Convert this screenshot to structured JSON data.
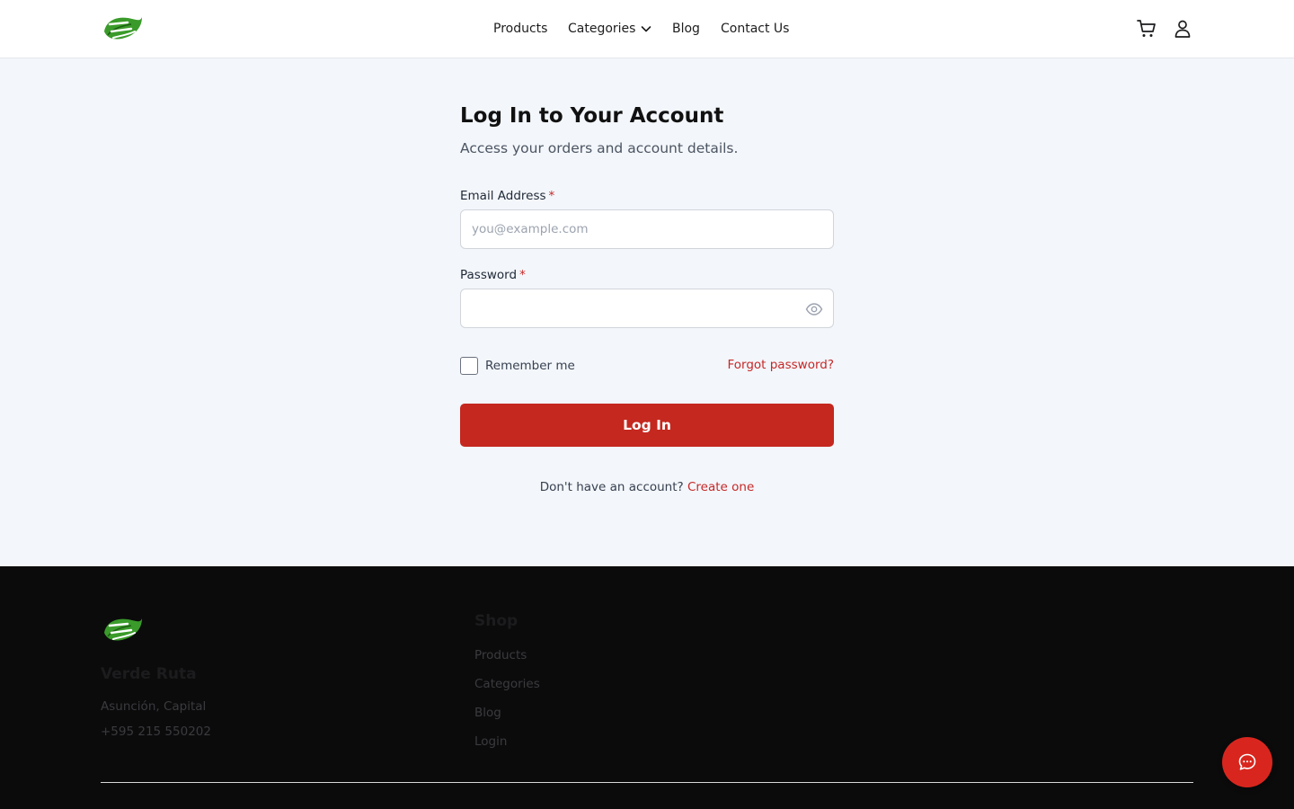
{
  "header": {
    "brand": "Verde Ruta",
    "nav": {
      "products": "Products",
      "categories": "Categories",
      "blog": "Blog",
      "contact": "Contact Us"
    }
  },
  "login": {
    "title": "Log In to Your Account",
    "subtitle": "Access your orders and account details.",
    "email_label": "Email Address",
    "email_placeholder": "you@example.com",
    "email_value": "",
    "password_label": "Password",
    "password_value": "",
    "required_mark": "*",
    "remember_label": "Remember me",
    "remember_checked": false,
    "forgot_label": "Forgot password?",
    "submit_label": "Log In",
    "signup_prompt": "Don't have an account?",
    "signup_link": "Create one"
  },
  "footer": {
    "brand": "Verde Ruta",
    "address": "Asunción, Capital",
    "phone": "+595 215 550202",
    "shop_heading": "Shop",
    "shop_links": [
      "Products",
      "Categories",
      "Blog",
      "Login"
    ]
  },
  "colors": {
    "accent": "#c4281f",
    "link": "#c62828",
    "page_bg": "#f3f6fa",
    "footer_bg": "#0b0b0c",
    "logo_green": "#3a9b2a"
  },
  "icons": {
    "cart": "shopping-cart-icon",
    "user": "user-icon",
    "eye": "eye-icon",
    "chat": "chat-bubble-icon",
    "chevron": "chevron-down-icon"
  }
}
